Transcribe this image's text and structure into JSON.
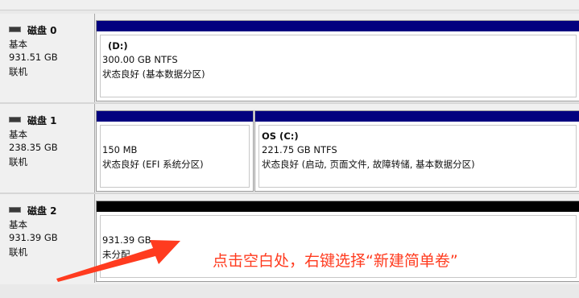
{
  "disks": [
    {
      "name": "磁盘 0",
      "type": "基本",
      "size": "931.51 GB",
      "status": "联机",
      "partitions": [
        {
          "name": "(D:)",
          "size_fs": "300.00 GB NTFS",
          "status": "状态良好 (基本数据分区)"
        }
      ]
    },
    {
      "name": "磁盘 1",
      "type": "基本",
      "size": "238.35 GB",
      "status": "联机",
      "partitions": [
        {
          "name": "",
          "size_fs": "150 MB",
          "status": "状态良好 (EFI 系统分区)"
        },
        {
          "name": "OS  (C:)",
          "size_fs": "221.75 GB NTFS",
          "status": "状态良好 (启动, 页面文件, 故障转储, 基本数据分区)"
        }
      ]
    },
    {
      "name": "磁盘 2",
      "type": "基本",
      "size": "931.39 GB",
      "status": "联机",
      "partitions": [
        {
          "name": "",
          "size_fs": "931.39 GB",
          "status": "未分配"
        }
      ]
    }
  ],
  "annotation": "点击空白处，右键选择“新建简单卷”",
  "colors": {
    "primary_partition_bar": "#02017f",
    "unallocated_bar": "#000000",
    "annotation": "#ff3b1f"
  },
  "icons": {
    "disk": "disk-drive-icon"
  }
}
